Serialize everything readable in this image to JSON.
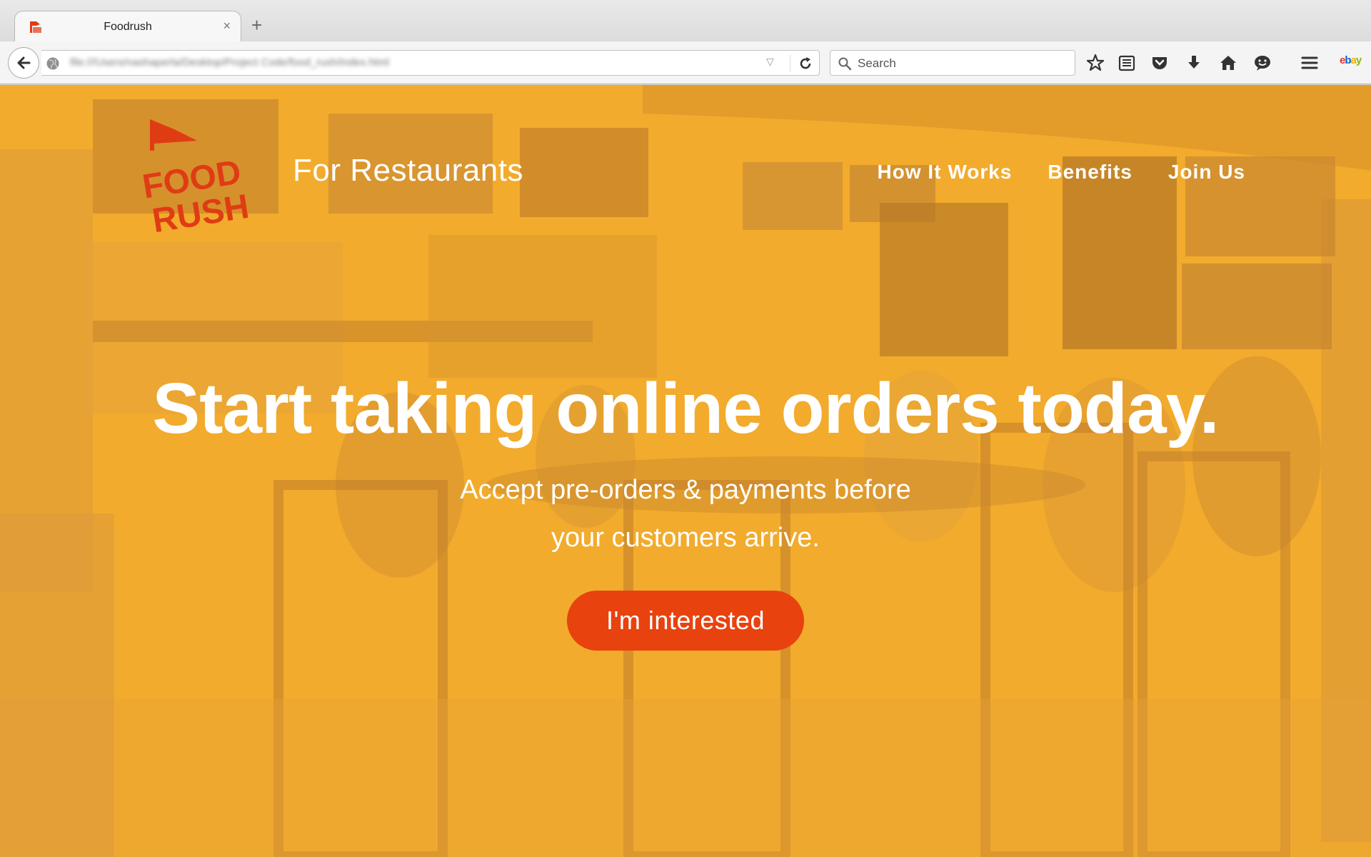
{
  "browser": {
    "tab_title": "Foodrush",
    "tab_close": "×",
    "new_tab": "+",
    "url": "file:///Users/nashaperla/Desktop/Project Code/food_rush/index.html",
    "search_placeholder": "Search",
    "toolbar_icons": [
      "bookmark-star-icon",
      "reading-list-icon",
      "pocket-icon",
      "download-icon",
      "home-icon",
      "chat-icon",
      "menu-icon"
    ],
    "ebay": {
      "e": "e",
      "b": "b",
      "a": "a",
      "y": "y"
    }
  },
  "page": {
    "logo_text": [
      "FOOD",
      "RUSH"
    ],
    "tagline": "For Restaurants",
    "nav": {
      "how_it_works": "How It Works",
      "benefits": "Benefits",
      "join_us": "Join Us"
    },
    "headline": "Start taking online orders today.",
    "subhead_line1": "Accept pre-orders & payments before",
    "subhead_line2": "your customers arrive.",
    "cta_label": "I'm interested"
  },
  "colors": {
    "overlay": "#f2ab2c",
    "accent": "#e8420f",
    "logo": "#e03c14"
  }
}
